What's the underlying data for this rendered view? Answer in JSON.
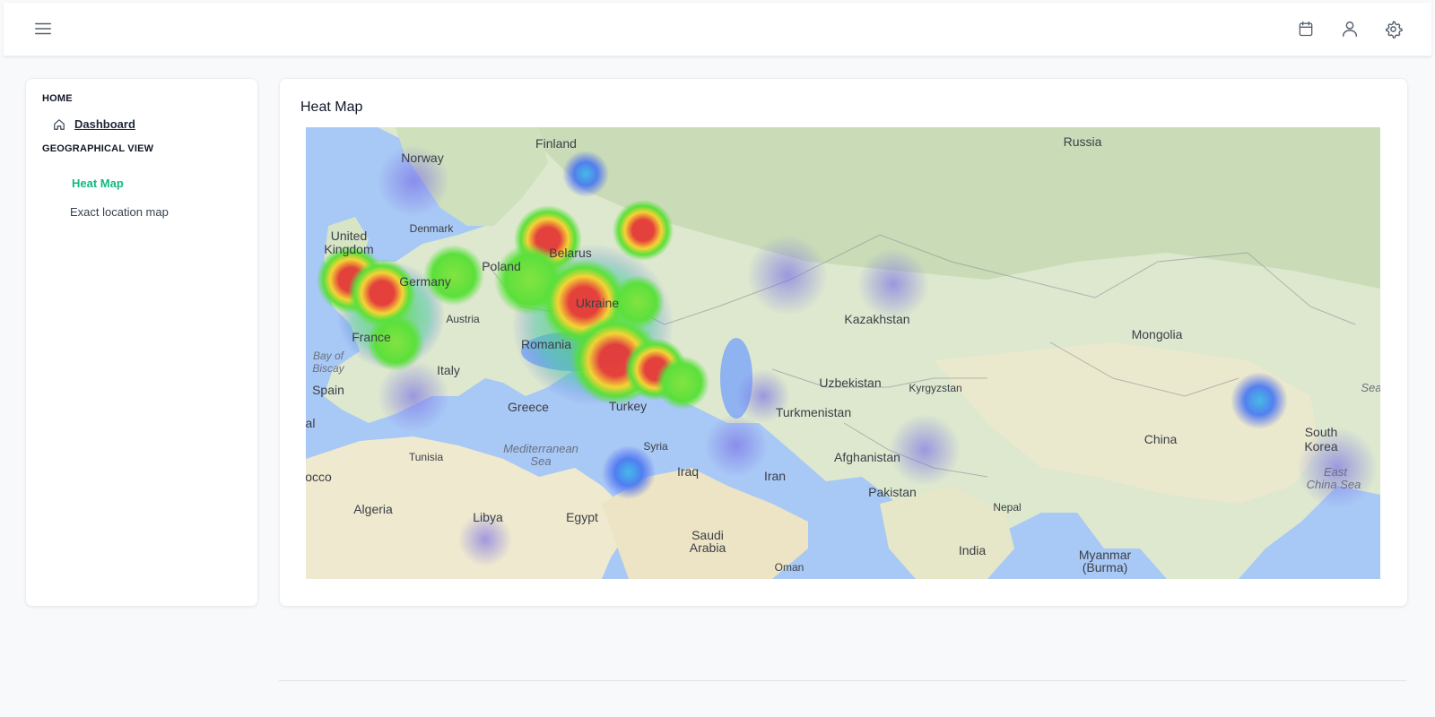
{
  "header": {
    "menu_icon": "hamburger-menu-icon",
    "calendar_icon": "calendar-icon",
    "user_icon": "user-icon",
    "settings_icon": "gear-icon"
  },
  "sidebar": {
    "home_label": "HOME",
    "dashboard_label": "Dashboard",
    "dashboard_icon": "home-icon",
    "geo_label": "GEOGRAPHICAL VIEW",
    "items": [
      {
        "label": "Heat Map",
        "active": true
      },
      {
        "label": "Exact location map",
        "active": false
      }
    ]
  },
  "main": {
    "title": "Heat Map",
    "map_labels": {
      "finland": "Finland",
      "russia": "Russia",
      "norway": "Norway",
      "denmark": "Denmark",
      "united": "United",
      "kingdom": "Kingdom",
      "poland": "Poland",
      "belarus": "Belarus",
      "germany": "Germany",
      "ukraine": "Ukraine",
      "austria": "Austria",
      "kazakhstan": "Kazakhstan",
      "mongolia": "Mongolia",
      "france": "France",
      "romania": "Romania",
      "bay": "Bay of",
      "biscay": "Biscay",
      "italy": "Italy",
      "uzbekistan": "Uzbekistan",
      "kyrgyzstan": "Kyrgyzstan",
      "spain": "Spain",
      "greece": "Greece",
      "turkey": "Turkey",
      "turkmenistan": "Turkmenistan",
      "china": "China",
      "south": "South",
      "korea": "Korea",
      "portugal_part": "al",
      "tunisia": "Tunisia",
      "med1": "Mediterranean",
      "med2": "Sea",
      "syria": "Syria",
      "afghanistan": "Afghanistan",
      "east1": "East",
      "east2": "China Sea",
      "sea_edge": "Sea",
      "morocco_part": "occo",
      "iraq": "Iraq",
      "iran": "Iran",
      "pakistan": "Pakistan",
      "nepal": "Nepal",
      "algeria": "Algeria",
      "libya": "Libya",
      "egypt": "Egypt",
      "saudi1": "Saudi",
      "saudi2": "Arabia",
      "india": "India",
      "myanmar1": "Myanmar",
      "myanmar2": "(Burma)",
      "oman": "Oman"
    }
  },
  "colors": {
    "accent": "#10b981",
    "water": "#a8c8f5",
    "land": "#e7eedc"
  }
}
